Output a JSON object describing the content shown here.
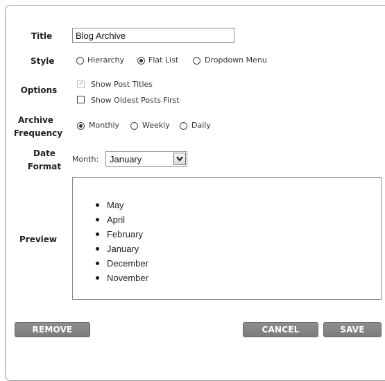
{
  "form": {
    "title_label": "Title",
    "title_value": "Blog Archive",
    "style_label": "Style",
    "style_options": [
      "Hierarchy",
      "Flat List",
      "Dropdown Menu"
    ],
    "style_selected": "Flat List",
    "options_label": "Options",
    "options": [
      {
        "label": "Show Post Titles",
        "checked": true,
        "disabled": true
      },
      {
        "label": "Show Oldest Posts First",
        "checked": false,
        "disabled": false
      }
    ],
    "archive_label_line1": "Archive",
    "archive_label_line2": "Frequency",
    "frequency_options": [
      "Monthly",
      "Weekly",
      "Daily"
    ],
    "frequency_selected": "Monthly",
    "date_label_line1": "Date",
    "date_label_line2": "Format",
    "month_label": "Month:",
    "month_value": "January",
    "preview_label": "Preview",
    "preview_items": [
      "May",
      "April",
      "February",
      "January",
      "December",
      "November"
    ]
  },
  "buttons": {
    "remove": "REMOVE",
    "cancel": "CANCEL",
    "save": "SAVE"
  }
}
